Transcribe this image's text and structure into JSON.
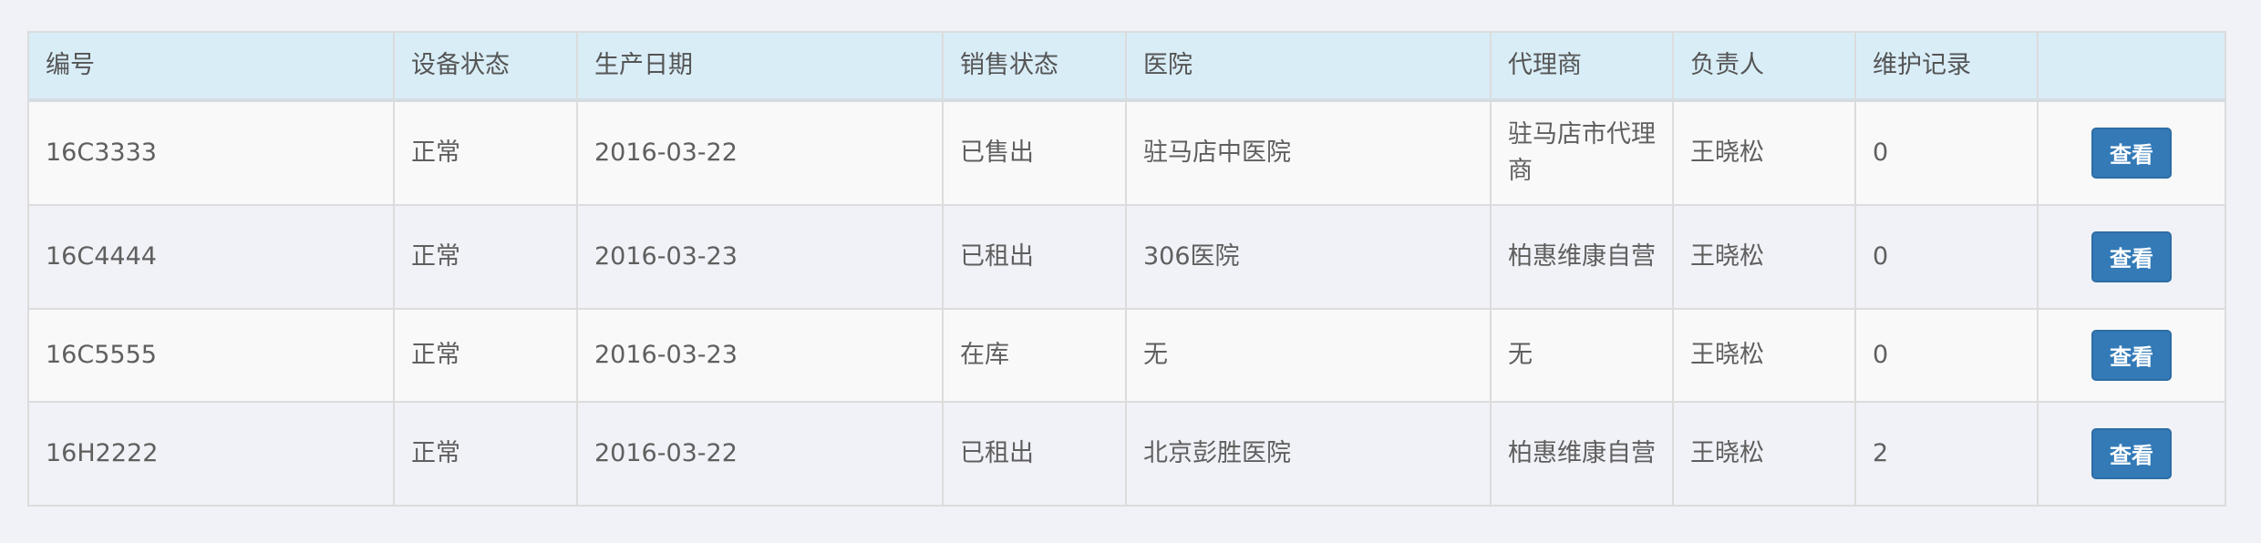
{
  "table": {
    "headers": [
      "编号",
      "设备状态",
      "生产日期",
      "销售状态",
      "医院",
      "代理商",
      "负责人",
      "维护记录",
      ""
    ],
    "rows": [
      {
        "id": "16C3333",
        "device_status": "正常",
        "production_date": "2016-03-22",
        "sales_status": "已售出",
        "hospital": "驻马店中医院",
        "agent": "驻马店市代理商",
        "owner": "王晓松",
        "maintenance": "0",
        "action": "查看"
      },
      {
        "id": "16C4444",
        "device_status": "正常",
        "production_date": "2016-03-23",
        "sales_status": "已租出",
        "hospital": "306医院",
        "agent": "柏惠维康自营",
        "owner": "王晓松",
        "maintenance": "0",
        "action": "查看"
      },
      {
        "id": "16C5555",
        "device_status": "正常",
        "production_date": "2016-03-23",
        "sales_status": "在库",
        "hospital": "无",
        "agent": "无",
        "owner": "王晓松",
        "maintenance": "0",
        "action": "查看"
      },
      {
        "id": "16H2222",
        "device_status": "正常",
        "production_date": "2016-03-22",
        "sales_status": "已租出",
        "hospital": "北京彭胜医院",
        "agent": "柏惠维康自营",
        "owner": "王晓松",
        "maintenance": "2",
        "action": "查看"
      }
    ]
  },
  "colors": {
    "header_bg": "#d9edf7",
    "button_bg": "#337ab7",
    "page_bg": "#f1f2f7"
  }
}
